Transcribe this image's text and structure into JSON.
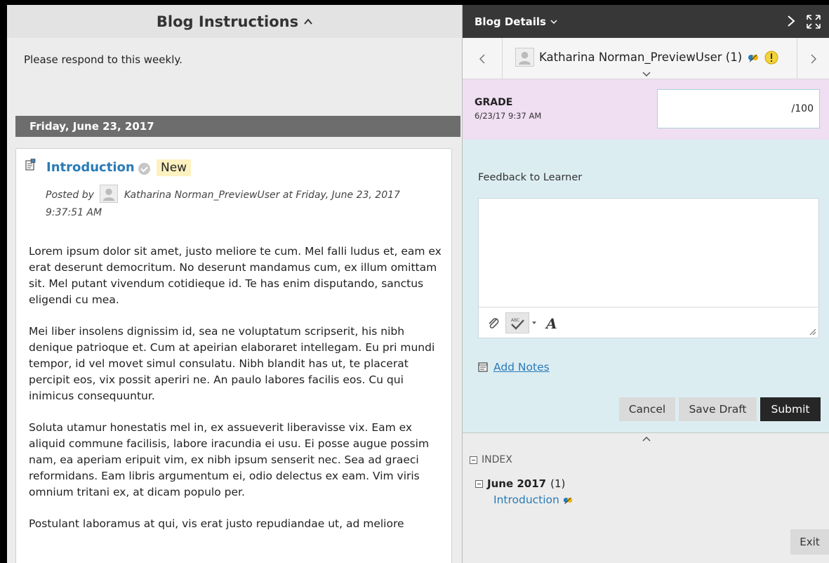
{
  "left": {
    "header_title": "Blog Instructions",
    "instructions": "Please respond to this weekly.",
    "date_bar": "Friday, June 23, 2017",
    "entry": {
      "title": "Introduction",
      "badge": "New",
      "posted_by_prefix": "Posted by",
      "author": "Katharina Norman_PreviewUser",
      "posted_at": "at Friday, June 23, 2017 9:37:51 AM",
      "paragraphs": [
        "Lorem ipsum dolor sit amet, justo meliore te cum. Mel falli ludus et, eam ex erat deserunt democritum. No deserunt mandamus cum, ex illum omittam sit. Mel putant vivendum cotidieque id. Te has enim disputando, sanctus eligendi cu mea.",
        "Mei liber insolens dignissim id, sea ne voluptatum scripserit, his nibh denique patrioque et. Cum at apeirian elaboraret intellegam. Eu pri mundi tempor, id vel movet simul consulatu. Nibh blandit has ut, te placerat percipit eos, vix possit aperiri ne. An paulo labores facilis eos. Cu qui inimicus consequuntur.",
        "Soluta utamur honestatis mel in, ex assueverit liberavisse vix. Eam ex aliquid commune facilisis, labore iracundia ei usu. Ei posse augue possim nam, ea aperiam eripuit vim, ex nibh ipsum senserit nec. Sea ad graeci reformidans. Eam libris argumentum ei, odio delectus ex eam. Vim viris omnium tritani ex, at dicam populo per.",
        "Postulant laboramus at qui, vis erat justo repudiandae ut, ad meliore"
      ]
    }
  },
  "right": {
    "header_title": "Blog Details",
    "user_name": "Katharina Norman_PreviewUser (1)",
    "grade_label": "GRADE",
    "grade_date": "6/23/17 9:37 AM",
    "grade_value": "",
    "grade_max": "/100",
    "feedback_label": "Feedback to Learner",
    "feedback_text": "",
    "add_notes": "Add Notes",
    "cancel": "Cancel",
    "save_draft": "Save Draft",
    "submit": "Submit",
    "index_label": "INDEX",
    "index_month": "June 2017",
    "index_month_count": "(1)",
    "index_entry": "Introduction",
    "exit": "Exit"
  },
  "colors": {
    "link": "#2a7bb7",
    "grade_bg": "#f0def2",
    "feedback_bg": "#dcedf2",
    "dark_header": "#373737",
    "new_badge": "#fdf1c0"
  },
  "icons": [
    "chevron-up-icon",
    "chevron-down-icon",
    "chevron-right-icon",
    "expand-icon",
    "chevron-left-icon",
    "avatar-icon",
    "needs-grading-icon",
    "alert-icon",
    "blog-entry-icon",
    "status-check-icon",
    "attach-icon",
    "spellcheck-icon",
    "font-icon",
    "notes-icon",
    "collapse-icon",
    "resize-grip-icon"
  ]
}
